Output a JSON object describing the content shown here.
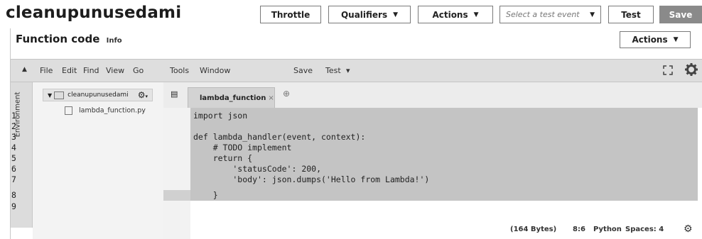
{
  "header": {
    "function_name": "cleanupunusedami",
    "throttle_label": "Throttle",
    "qualifiers_label": "Qualifiers",
    "actions_label": "Actions",
    "test_event_placeholder": "Select a test event",
    "test_label": "Test",
    "save_label": "Save"
  },
  "section": {
    "title": "Function code",
    "info_link": "Info",
    "actions_label": "Actions"
  },
  "ide_menu": {
    "items": [
      "File",
      "Edit",
      "Find",
      "View",
      "Go",
      "Tools",
      "Window"
    ],
    "save_label": "Save",
    "test_label": "Test"
  },
  "environment": {
    "label": "Environment",
    "root_folder": "cleanupunusedami",
    "file": "lambda_function.py"
  },
  "editor": {
    "tab_label": "lambda_function",
    "line_numbers": [
      "1",
      "2",
      "3",
      "4",
      "5",
      "6",
      "7",
      "8",
      "9"
    ],
    "lines": [
      "import json",
      "",
      "def lambda_handler(event, context):",
      "    # TODO implement",
      "    return {",
      "        'statusCode': 200,",
      "        'body': json.dumps('Hello from Lambda!')",
      "    }",
      ""
    ]
  },
  "status_bar": {
    "size": "(164 Bytes)",
    "cursor": "8:6",
    "language": "Python",
    "indent": "Spaces: 4"
  }
}
